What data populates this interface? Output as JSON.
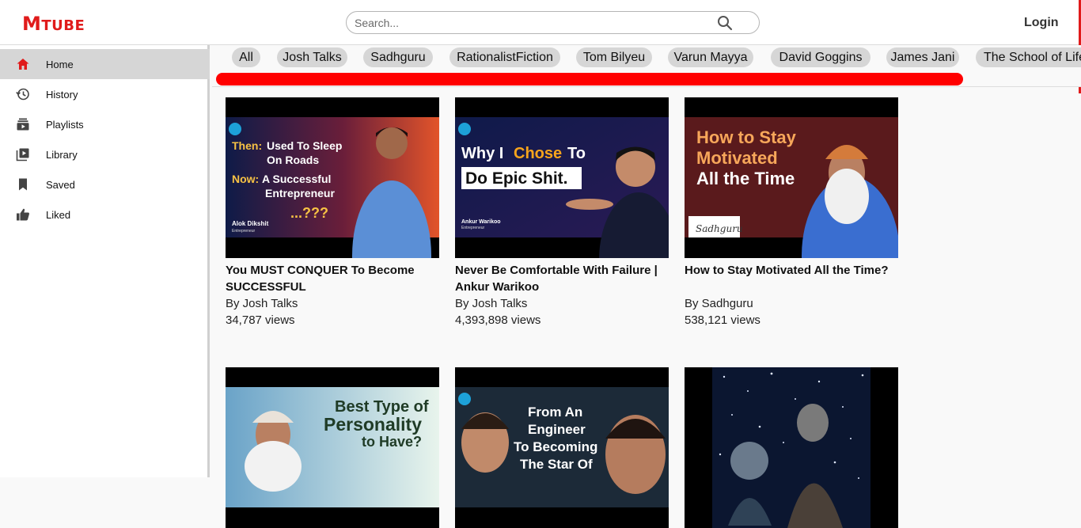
{
  "header": {
    "logo_big": "M",
    "logo_small": "TUBE",
    "search_placeholder": "Search...",
    "login_label": "Login"
  },
  "sidebar": {
    "items": [
      {
        "label": "Home",
        "icon": "home-icon"
      },
      {
        "label": "History",
        "icon": "history-icon"
      },
      {
        "label": "Playlists",
        "icon": "playlists-icon"
      },
      {
        "label": "Library",
        "icon": "library-icon"
      },
      {
        "label": "Saved",
        "icon": "bookmark-icon"
      },
      {
        "label": "Liked",
        "icon": "thumbs-up-icon"
      }
    ]
  },
  "chips": [
    "All",
    "Josh Talks",
    "Sadhguru",
    "RationalistFiction",
    "Tom Bilyeu",
    "Varun Mayya",
    "David Goggins",
    "James Jani",
    "The School of Life"
  ],
  "videos": [
    {
      "title": "You MUST CONQUER To Become SUCCESSFUL",
      "author": "By Josh Talks",
      "views": "34,787 views",
      "thumb": {
        "line1a": "Then:",
        "line1b": "Used To Sleep",
        "line2": "On Roads",
        "line3a": "Now:",
        "line3b": "A Successful",
        "line4": "Entrepreneur",
        "line5": "...???",
        "name": "Alok Dikshit",
        "role": "Entrepreneur"
      }
    },
    {
      "title": "Never Be Comfortable With Failure | Ankur Warikoo",
      "author": "By Josh Talks",
      "views": "4,393,898 views",
      "thumb": {
        "line1a": "Why I",
        "line1b": "Chose",
        "line1c": "To",
        "line2": "Do Epic Shit.",
        "name": "Ankur Warikoo",
        "role": "Entrepreneur"
      }
    },
    {
      "title": "How to Stay Motivated All the Time?",
      "author": "By Sadhguru",
      "views": "538,121 views",
      "thumb": {
        "line1": "How to Stay",
        "line2": "Motivated",
        "line3": "All the Time",
        "sig": "Sadhguru"
      }
    },
    {
      "thumb": {
        "line1": "Best Type of",
        "line2": "Personality",
        "line3": "to Have?"
      }
    },
    {
      "thumb": {
        "line1": "From An",
        "line2": "Engineer",
        "line3": "To Becoming",
        "line4": "The Star Of"
      }
    },
    {
      "thumb": {}
    }
  ],
  "colors": {
    "brand": "#e01b1b",
    "active": "#d6d6d6",
    "scrollbar": "#ff0000"
  }
}
